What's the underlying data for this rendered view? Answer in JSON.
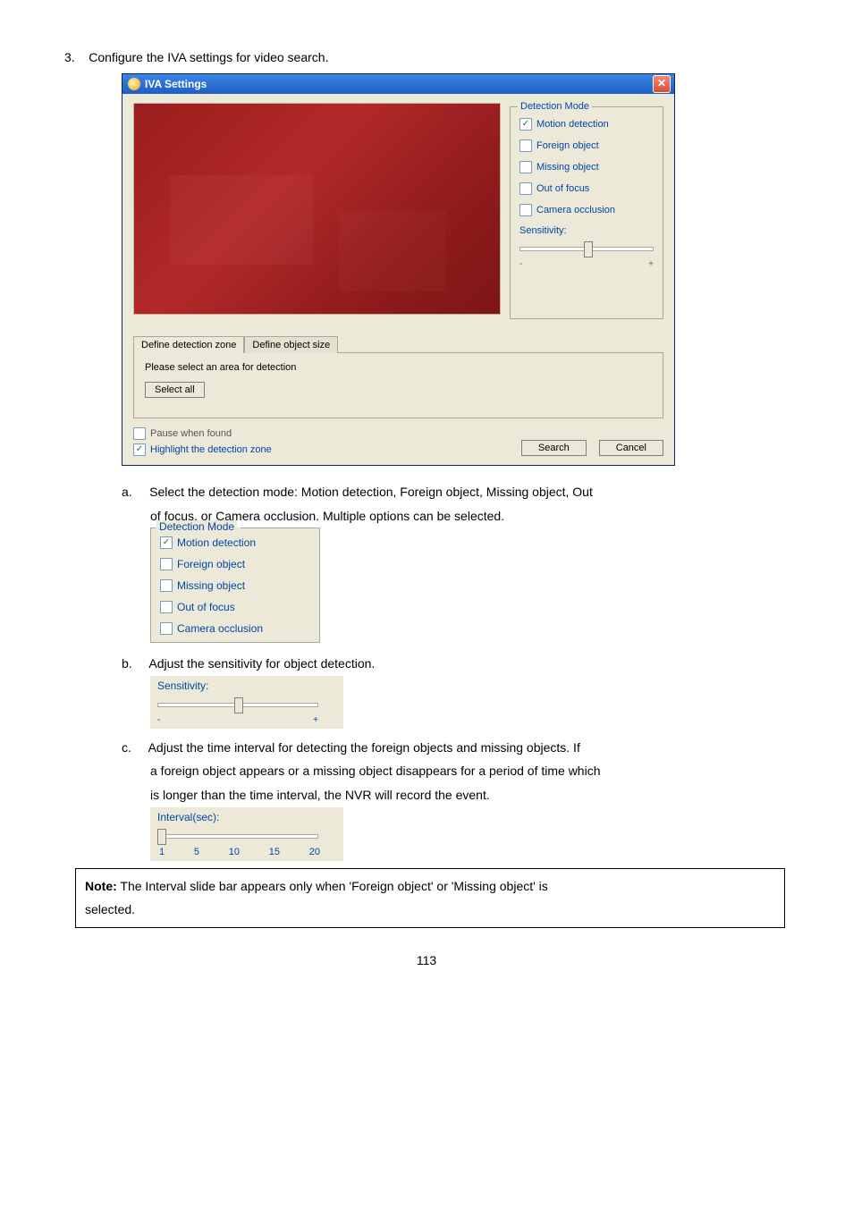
{
  "step3": {
    "num": "3.",
    "text": "Configure the IVA settings for video search."
  },
  "dialog": {
    "title": "IVA Settings",
    "close": "✕",
    "detection_mode_legend": "Detection Mode",
    "motion_detection": "Motion detection",
    "foreign_object": "Foreign object",
    "missing_object": "Missing object",
    "out_of_focus": "Out of focus",
    "camera_occlusion": "Camera occlusion",
    "sensitivity_label": "Sensitivity:",
    "sens_minus": "-",
    "sens_plus": "+",
    "tab_define_zone": "Define detection zone",
    "tab_define_size": "Define object size",
    "select_area_text": "Please select an area for detection",
    "select_all_btn": "Select all",
    "pause_when_found": "Pause when found",
    "highlight_zone": "Highlight the detection zone",
    "search_btn": "Search",
    "cancel_btn": "Cancel"
  },
  "substeps": {
    "a_label": "a.",
    "a_text1": "Select the detection mode: Motion detection, Foreign object, Missing object, Out",
    "a_text2": "of focus, or Camera occlusion.   Multiple options can be selected.",
    "b_label": "b.",
    "b_text": "Adjust the sensitivity for object detection.",
    "c_label": "c.",
    "c_text1": "Adjust the time interval for detecting the foreign objects and missing objects.   If",
    "c_text2": "a foreign object appears or a missing object disappears for a period of time which",
    "c_text3": "is longer than the time interval, the NVR will record the event."
  },
  "detmode_crop": {
    "legend": "Detection Mode",
    "motion": "Motion detection",
    "foreign": "Foreign object",
    "missing": "Missing object",
    "oof": "Out of focus",
    "occlusion": "Camera occlusion"
  },
  "sens_crop": {
    "label": "Sensitivity:",
    "minus": "-",
    "plus": "+"
  },
  "interval_crop": {
    "label": "Interval(sec):",
    "ticks": [
      "1",
      "5",
      "10",
      "15",
      "20"
    ]
  },
  "note": {
    "bold": "Note:",
    "text1": " The Interval slide bar appears only when 'Foreign object' or 'Missing object' is",
    "text2": "selected."
  },
  "pagenum": "113"
}
